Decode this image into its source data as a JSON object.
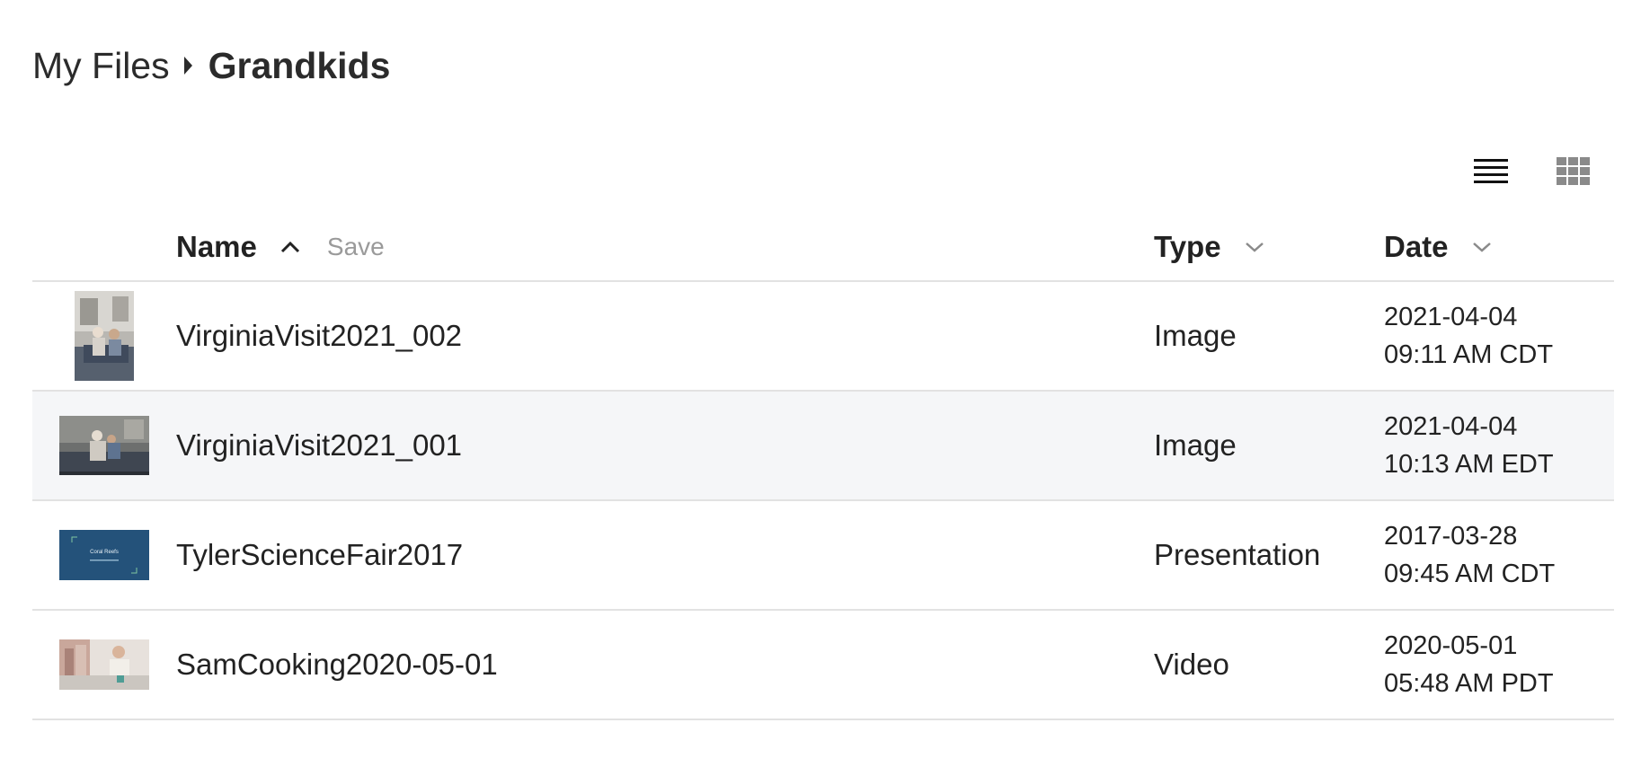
{
  "breadcrumb": {
    "root": "My Files",
    "current": "Grandkids"
  },
  "view_toggle": {
    "list_icon": "list-view-icon",
    "grid_icon": "grid-view-icon"
  },
  "columns": {
    "name": "Name",
    "save": "Save",
    "type": "Type",
    "date": "Date"
  },
  "files": [
    {
      "name": "VirginiaVisit2021_002",
      "type": "Image",
      "date": "2021-04-04",
      "time": "09:11 AM CDT",
      "thumb": "photo-portrait-thumbnail"
    },
    {
      "name": "VirginiaVisit2021_001",
      "type": "Image",
      "date": "2021-04-04",
      "time": "10:13 AM EDT",
      "thumb": "photo-landscape-thumbnail"
    },
    {
      "name": "TylerScienceFair2017",
      "type": "Presentation",
      "date": "2017-03-28",
      "time": "09:45 AM CDT",
      "thumb": "slide-thumbnail",
      "thumb_text": "Coral Reefs"
    },
    {
      "name": "SamCooking2020-05-01",
      "type": "Video",
      "date": "2020-05-01",
      "time": "05:48 AM PDT",
      "thumb": "video-thumbnail"
    }
  ],
  "colors": {
    "text": "#222222",
    "muted": "#9a9a9a",
    "divider": "#e2e2e2",
    "row_alt": "#f5f6f8",
    "slide_bg": "#24527a"
  }
}
